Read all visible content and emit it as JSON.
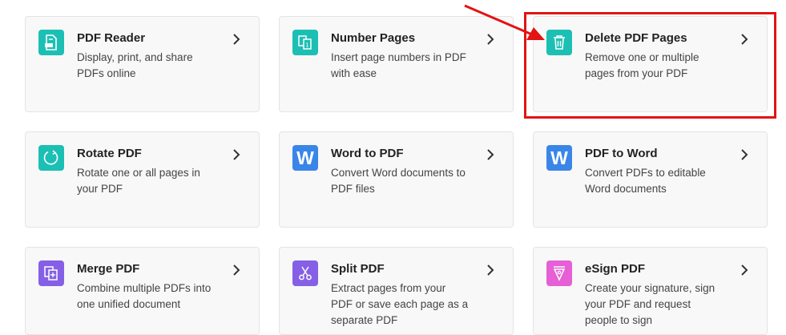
{
  "tools": [
    {
      "title": "PDF Reader",
      "desc": "Display, print, and share PDFs online",
      "icon": "pdf-reader-icon",
      "color": "#1cbfb4"
    },
    {
      "title": "Number Pages",
      "desc": "Insert page numbers in PDF with ease",
      "icon": "number-pages-icon",
      "color": "#1cbfb4"
    },
    {
      "title": "Delete PDF Pages",
      "desc": "Remove one or multiple pages from your PDF",
      "icon": "trash-icon",
      "color": "#1cbfb4"
    },
    {
      "title": "Rotate PDF",
      "desc": "Rotate one or all pages in your PDF",
      "icon": "rotate-icon",
      "color": "#1cbfb4"
    },
    {
      "title": "Word to PDF",
      "desc": "Convert Word documents to PDF files",
      "icon": "word-icon",
      "icon_text": "W",
      "color": "#3a86e8"
    },
    {
      "title": "PDF to Word",
      "desc": "Convert PDFs to editable Word documents",
      "icon": "word-icon",
      "icon_text": "W",
      "color": "#3a86e8"
    },
    {
      "title": "Merge PDF",
      "desc": "Combine multiple PDFs into one unified document",
      "icon": "merge-icon",
      "color": "#8560e6"
    },
    {
      "title": "Split PDF",
      "desc": "Extract pages from your PDF or save each page as a separate PDF",
      "icon": "scissors-icon",
      "color": "#8560e6"
    },
    {
      "title": "eSign PDF",
      "desc": "Create your signature, sign your PDF and request people to sign",
      "icon": "esign-icon",
      "color": "#e65fd6"
    }
  ],
  "annotation": {
    "highlight_color": "#e21414",
    "highlighted_tool": "Delete PDF Pages"
  }
}
